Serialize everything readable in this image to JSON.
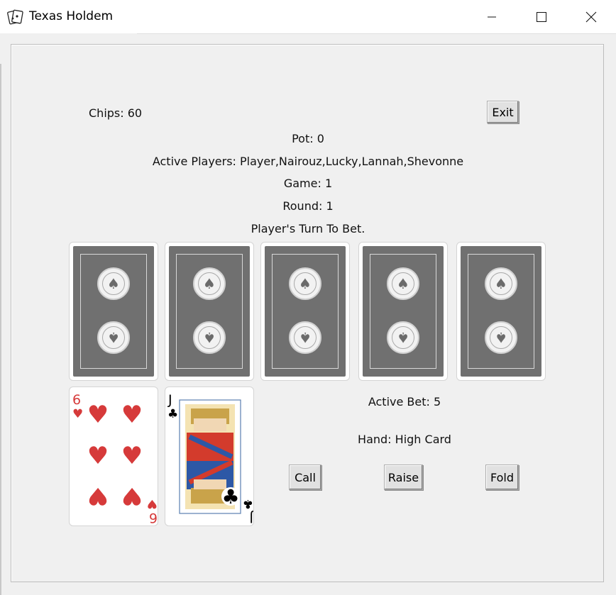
{
  "window": {
    "title": "Texas Holdem",
    "icon": "cards-icon",
    "controls": [
      "minimize-icon",
      "maximize-icon",
      "close-icon"
    ]
  },
  "status": {
    "chips": "Chips: 60",
    "pot": "Pot: 0",
    "active_players": "Active Players: Player,Nairouz,Lucky,Lannah,Shevonne",
    "game": "Game: 1",
    "round": "Round: 1",
    "turn": "Player's Turn To Bet."
  },
  "community_cards": [
    {
      "face": "back"
    },
    {
      "face": "back"
    },
    {
      "face": "back"
    },
    {
      "face": "back"
    },
    {
      "face": "back"
    }
  ],
  "hand_cards": [
    {
      "rank": "6",
      "suit": "♥",
      "suit_name": "hearts",
      "color": "#d63a3a"
    },
    {
      "rank": "J",
      "suit": "♣",
      "suit_name": "clubs",
      "color": "#000000"
    }
  ],
  "betting": {
    "active_bet": "Active Bet: 5",
    "hand": "Hand: High Card"
  },
  "buttons": {
    "exit": "Exit",
    "call": "Call",
    "raise": "Raise",
    "fold": "Fold"
  },
  "colors": {
    "card_back": "#707070",
    "hearts_red": "#d63a3a",
    "window_bg": "#f0f0f0"
  }
}
